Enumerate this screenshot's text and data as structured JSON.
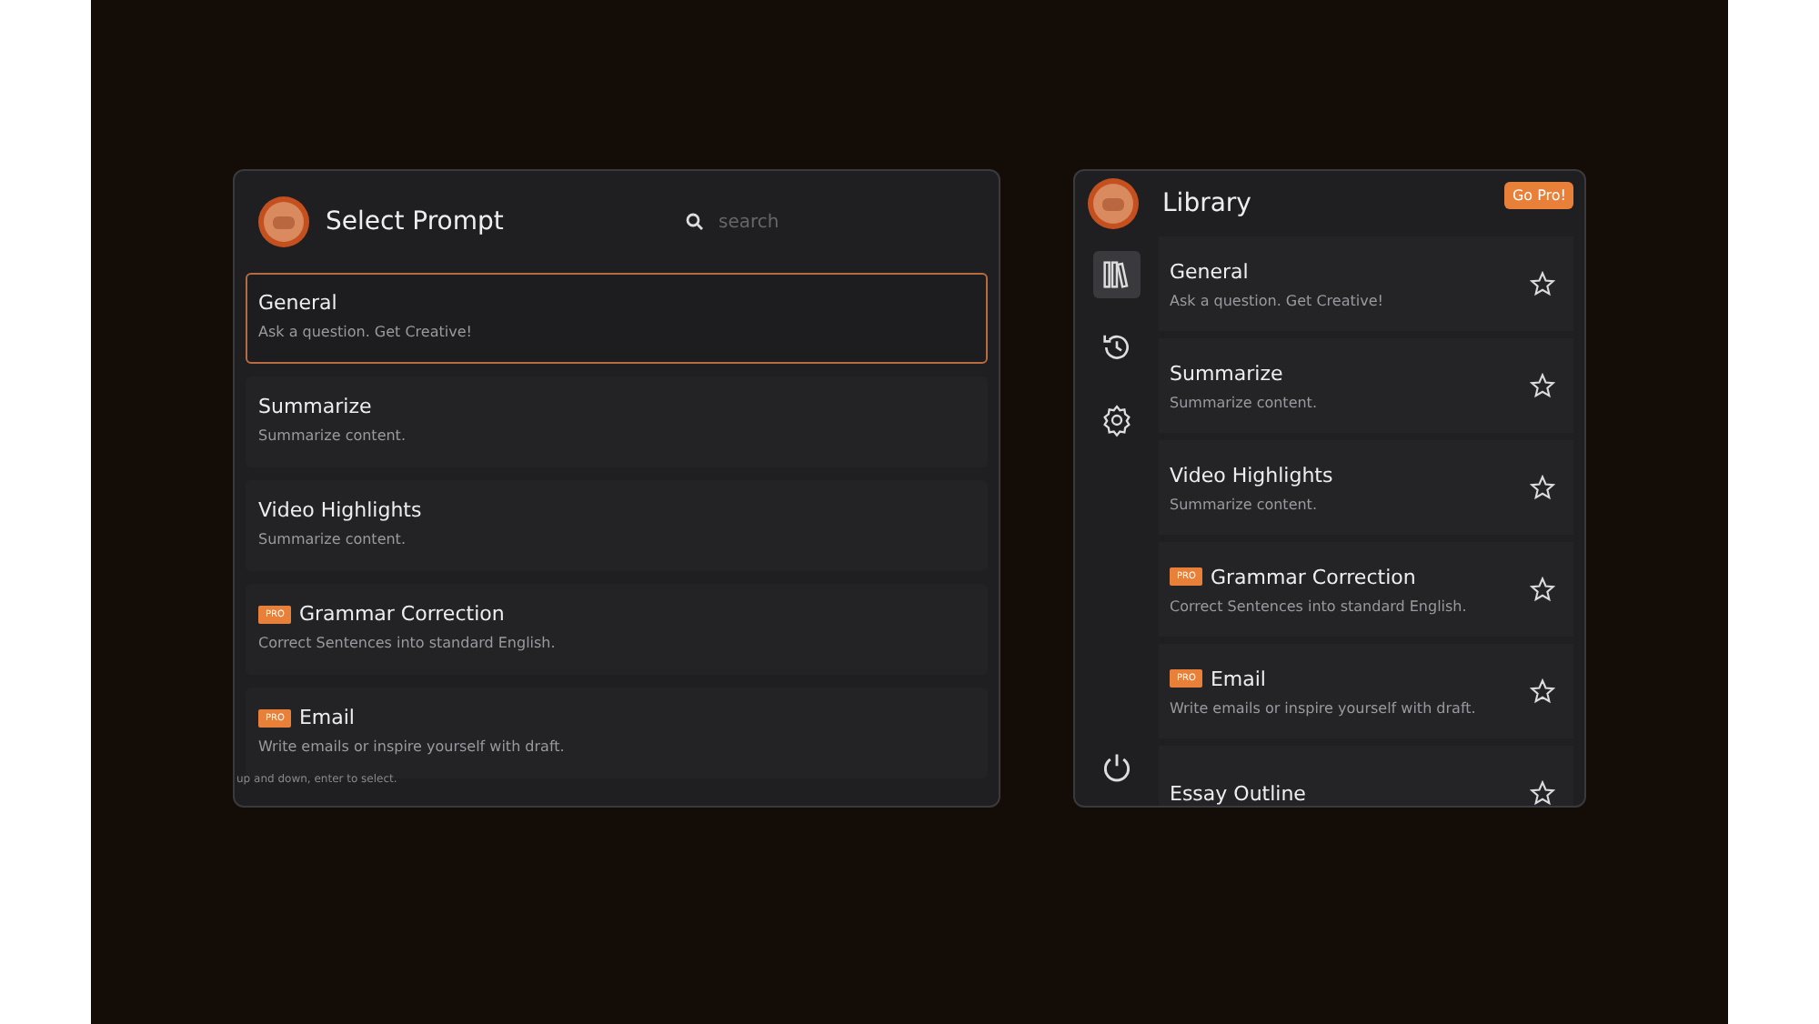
{
  "select_prompt": {
    "title": "Select Prompt",
    "search": {
      "placeholder": "search"
    },
    "items": [
      {
        "title": "General",
        "description": "Ask a question. Get Creative!",
        "selected": true
      },
      {
        "title": "Summarize",
        "description": "Summarize content.",
        "selected": false
      },
      {
        "title": "Video Highlights",
        "description": "Summarize content.",
        "selected": false
      },
      {
        "title": "Grammar Correction",
        "description": "Correct Sentences into standard English.",
        "badge": "PRO",
        "selected": false
      },
      {
        "title": "Email",
        "description": "Write emails or inspire yourself with draft.",
        "badge": "PRO",
        "selected": false
      }
    ],
    "hint": "up and down, enter to select."
  },
  "library": {
    "title": "Library",
    "upgrade_button": "Go Pro!",
    "nav": [
      {
        "kind": "library",
        "selected": true
      },
      {
        "kind": "history",
        "selected": false
      },
      {
        "kind": "settings",
        "selected": false
      }
    ],
    "items": [
      {
        "title": "General",
        "description": "Ask a question. Get Creative!",
        "starred": false
      },
      {
        "title": "Summarize",
        "description": "Summarize content.",
        "starred": false
      },
      {
        "title": "Video Highlights",
        "description": "Summarize content.",
        "starred": false
      },
      {
        "title": "Grammar Correction",
        "description": "Correct Sentences into standard English.",
        "badge": "PRO",
        "starred": false
      },
      {
        "title": "Email",
        "description": "Write emails or inspire yourself with draft.",
        "badge": "PRO",
        "starred": false
      },
      {
        "title": "Essay Outline",
        "starred": false
      }
    ]
  }
}
